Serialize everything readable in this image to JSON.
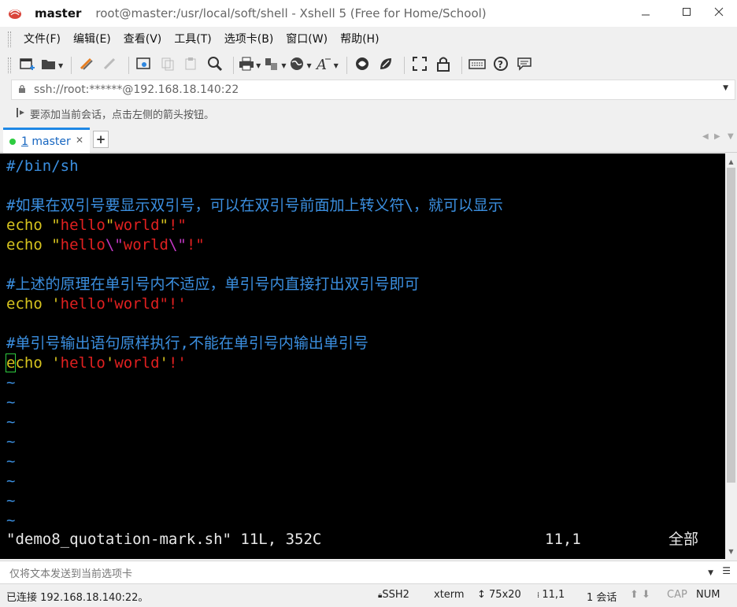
{
  "window": {
    "host": "master",
    "title": "root@master:/usr/local/soft/shell - Xshell 5 (Free for Home/School)",
    "minimize_icon": "minimize-icon",
    "maximize_icon": "maximize-icon",
    "close_icon": "close-icon"
  },
  "menu": {
    "items": [
      {
        "label": "文件(F)"
      },
      {
        "label": "编辑(E)"
      },
      {
        "label": "查看(V)"
      },
      {
        "label": "工具(T)"
      },
      {
        "label": "选项卡(B)"
      },
      {
        "label": "窗口(W)"
      },
      {
        "label": "帮助(H)"
      }
    ]
  },
  "address": {
    "value": "ssh://root:******@192.168.18.140:22"
  },
  "hint": {
    "text": "要添加当前会话，点击左侧的箭头按钮。"
  },
  "tabs": [
    {
      "number": "1",
      "label": "master",
      "status_color": "#2ecc40"
    }
  ],
  "tab_add_label": "+",
  "terminal": {
    "lines": [
      {
        "segments": [
          {
            "text": "#/bin/sh",
            "style": "comment"
          }
        ]
      },
      {
        "segments": []
      },
      {
        "segments": [
          {
            "text": "#如果在双引号要显示双引号，可以在双引号前面加上转义符\\，就可以显示",
            "style": "comment"
          }
        ]
      },
      {
        "segments": [
          {
            "text": "echo ",
            "style": "yellow"
          },
          {
            "text": "\"",
            "style": "yellow"
          },
          {
            "text": "hello",
            "style": "red"
          },
          {
            "text": "\"",
            "style": "yellow"
          },
          {
            "text": "world",
            "style": "red"
          },
          {
            "text": "\"",
            "style": "yellow"
          },
          {
            "text": "!\"",
            "style": "red"
          }
        ]
      },
      {
        "segments": [
          {
            "text": "echo ",
            "style": "yellow"
          },
          {
            "text": "\"",
            "style": "yellow"
          },
          {
            "text": "hello",
            "style": "red"
          },
          {
            "text": "\\\"",
            "style": "magenta"
          },
          {
            "text": "world",
            "style": "red"
          },
          {
            "text": "\\\"",
            "style": "magenta"
          },
          {
            "text": "!\"",
            "style": "red"
          }
        ]
      },
      {
        "segments": []
      },
      {
        "segments": [
          {
            "text": "#上述的原理在单引号内不适应，单引号内直接打出双引号即可",
            "style": "comment"
          }
        ]
      },
      {
        "segments": [
          {
            "text": "echo ",
            "style": "yellow"
          },
          {
            "text": "'",
            "style": "yellow"
          },
          {
            "text": "hello\"world\"!'",
            "style": "red"
          }
        ]
      },
      {
        "segments": []
      },
      {
        "segments": [
          {
            "text": "#单引号输出语句原样执行,不能在单引号内输出单引号",
            "style": "comment"
          }
        ]
      },
      {
        "segments": [
          {
            "text": "e",
            "style": "yellow",
            "cursor": true
          },
          {
            "text": "cho ",
            "style": "yellow"
          },
          {
            "text": "'",
            "style": "yellow"
          },
          {
            "text": "hello",
            "style": "red"
          },
          {
            "text": "'",
            "style": "yellow"
          },
          {
            "text": "world",
            "style": "red"
          },
          {
            "text": "'",
            "style": "yellow"
          },
          {
            "text": "!'",
            "style": "red"
          }
        ]
      },
      {
        "segments": [
          {
            "text": "~",
            "style": "tilde"
          }
        ]
      },
      {
        "segments": [
          {
            "text": "~",
            "style": "tilde"
          }
        ]
      },
      {
        "segments": [
          {
            "text": "~",
            "style": "tilde"
          }
        ]
      },
      {
        "segments": [
          {
            "text": "~",
            "style": "tilde"
          }
        ]
      },
      {
        "segments": [
          {
            "text": "~",
            "style": "tilde"
          }
        ]
      },
      {
        "segments": [
          {
            "text": "~",
            "style": "tilde"
          }
        ]
      },
      {
        "segments": [
          {
            "text": "~",
            "style": "tilde"
          }
        ]
      },
      {
        "segments": [
          {
            "text": "~",
            "style": "tilde"
          }
        ]
      }
    ],
    "status": {
      "file": "\"demo8_quotation-mark.sh\" 11L, 352C",
      "position": "11,1",
      "scope": "全部"
    }
  },
  "sendbar": {
    "placeholder": "仅将文本发送到当前选项卡"
  },
  "statusbar": {
    "connection": "已连接 192.168.18.140:22。",
    "protocol": "SSH2",
    "term": "xterm",
    "size": "75x20",
    "cursor": "11,1",
    "sessions": "1 会话",
    "cap": "CAP",
    "num": "NUM"
  }
}
